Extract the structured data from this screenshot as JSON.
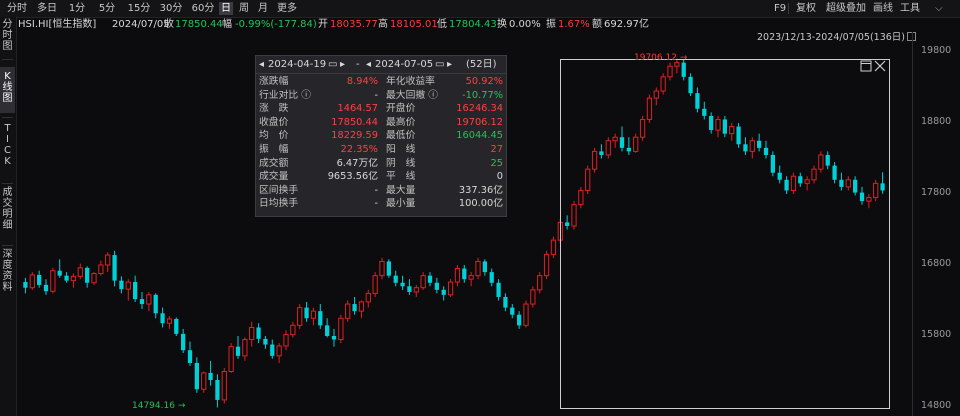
{
  "toolbar": {
    "timeframes": [
      "分时",
      "多日",
      "1分",
      "5分",
      "15分",
      "30分",
      "60分",
      "日",
      "周",
      "月",
      "更多"
    ],
    "active_timeframe": "日",
    "right": {
      "f9": "F9",
      "replay": "复权",
      "overlay": "超级叠加",
      "draw": "画线",
      "tools": "工具"
    }
  },
  "info": {
    "symbol": "HSI.HI[恒生指数]",
    "date": "2024/07/05",
    "close_label": "收",
    "close": "17850.44",
    "change_label": "幅",
    "change": "-0.99%(-177.84)",
    "open_label": "开",
    "open": "18035.77",
    "high_label": "高",
    "high": "18105.01",
    "low_label": "低",
    "low": "17804.43",
    "turnover_label": "换",
    "turnover": "0.00%",
    "amplitude_label": "振",
    "amplitude": "1.67%",
    "amount_label": "额",
    "amount": "692.97亿"
  },
  "left_tabs": [
    "分时图",
    "K线图",
    "TICK",
    "成交明细",
    "深度资料"
  ],
  "active_left_tab": "K线图",
  "range_label": "2023/12/13-2024/07/05(136日)",
  "y_axis": {
    "ticks": [
      "19800",
      "18800",
      "17800",
      "16800",
      "15800",
      "14800"
    ]
  },
  "highlights": {
    "high": "19706.12",
    "low": "14794.16"
  },
  "panel": {
    "start_date": "2024-04-19",
    "dash": "-",
    "end_date": "2024-07-05",
    "days": "(52日)",
    "rows": [
      {
        "l1": "涨跌幅",
        "v1": "8.94%",
        "l2": "年化收益率",
        "v2": "50.92%"
      },
      {
        "l1": "行业对比 ⓘ",
        "v1": "-",
        "l2": "最大回撤 ⓘ",
        "v2": "-10.77%"
      },
      {
        "l1": "涨　跌",
        "v1": "1464.57",
        "l2": "开盘价",
        "v2": "16246.34"
      },
      {
        "l1": "收盘价",
        "v1": "17850.44",
        "l2": "最高价",
        "v2": "19706.12"
      },
      {
        "l1": "均　价",
        "v1": "18229.59",
        "l2": "最低价",
        "v2": "16044.45"
      },
      {
        "l1": "振　幅",
        "v1": "22.35%",
        "l2": "阳　线",
        "v2": "27"
      },
      {
        "l1": "成交额",
        "v1": "6.47万亿",
        "l2": "阴　线",
        "v2": "25"
      },
      {
        "l1": "成交量",
        "v1": "9653.56亿",
        "l2": "平　线",
        "v2": "0"
      },
      {
        "l1": "区间换手",
        "v1": "-",
        "l2": "最大量",
        "v2": "337.36亿"
      },
      {
        "l1": "日均换手",
        "v1": "-",
        "l2": "最小量",
        "v2": "100.00亿"
      }
    ]
  },
  "colors": {
    "up": "#e02020",
    "down": "#00d0d8",
    "bg": "#0c0c0e"
  },
  "chart_data": {
    "type": "candlestick",
    "ylim": [
      14800,
      19800
    ],
    "up_color": "#e02020",
    "down_color": "#00d0d8",
    "candles": [
      [
        16560,
        16620,
        16400,
        16480
      ],
      [
        16480,
        16700,
        16450,
        16660
      ],
      [
        16660,
        16720,
        16480,
        16520
      ],
      [
        16520,
        16600,
        16380,
        16430
      ],
      [
        16430,
        16760,
        16400,
        16720
      ],
      [
        16720,
        16880,
        16620,
        16650
      ],
      [
        16650,
        16700,
        16550,
        16580
      ],
      [
        16580,
        16680,
        16480,
        16640
      ],
      [
        16640,
        16820,
        16600,
        16760
      ],
      [
        16760,
        16780,
        16480,
        16550
      ],
      [
        16550,
        16700,
        16520,
        16680
      ],
      [
        16680,
        16860,
        16650,
        16800
      ],
      [
        16800,
        16980,
        16700,
        16940
      ],
      [
        16940,
        17000,
        16500,
        16580
      ],
      [
        16580,
        16640,
        16400,
        16460
      ],
      [
        16460,
        16600,
        16300,
        16560
      ],
      [
        16560,
        16650,
        16280,
        16320
      ],
      [
        16320,
        16420,
        16180,
        16250
      ],
      [
        16250,
        16420,
        16150,
        16380
      ],
      [
        16380,
        16400,
        16050,
        16120
      ],
      [
        16120,
        16200,
        15920,
        15980
      ],
      [
        15980,
        16080,
        15900,
        16040
      ],
      [
        16040,
        16060,
        15800,
        15830
      ],
      [
        15830,
        15900,
        15560,
        15600
      ],
      [
        15600,
        15720,
        15380,
        15420
      ],
      [
        15420,
        15500,
        15000,
        15050
      ],
      [
        15050,
        15300,
        15000,
        15280
      ],
      [
        15280,
        15450,
        15100,
        15180
      ],
      [
        15180,
        15260,
        14794,
        14900
      ],
      [
        14900,
        15350,
        14850,
        15300
      ],
      [
        15300,
        15700,
        15280,
        15650
      ],
      [
        15650,
        15800,
        15480,
        15520
      ],
      [
        15520,
        15780,
        15450,
        15750
      ],
      [
        15750,
        16000,
        15650,
        15920
      ],
      [
        15920,
        15980,
        15700,
        15760
      ],
      [
        15760,
        15800,
        15620,
        15680
      ],
      [
        15680,
        15750,
        15480,
        15520
      ],
      [
        15520,
        15700,
        15420,
        15660
      ],
      [
        15660,
        15880,
        15600,
        15820
      ],
      [
        15820,
        16000,
        15780,
        15950
      ],
      [
        15950,
        16250,
        15900,
        16200
      ],
      [
        16200,
        16280,
        16000,
        16050
      ],
      [
        16050,
        16200,
        15950,
        16150
      ],
      [
        16150,
        16250,
        15900,
        15950
      ],
      [
        15950,
        16050,
        15780,
        15800
      ],
      [
        15800,
        15900,
        15650,
        15750
      ],
      [
        15750,
        16100,
        15700,
        16050
      ],
      [
        16050,
        16300,
        16000,
        16250
      ],
      [
        16250,
        16350,
        16100,
        16150
      ],
      [
        16150,
        16300,
        16050,
        16280
      ],
      [
        16280,
        16450,
        16200,
        16400
      ],
      [
        16400,
        16700,
        16350,
        16650
      ],
      [
        16650,
        16900,
        16600,
        16850
      ],
      [
        16850,
        16880,
        16620,
        16650
      ],
      [
        16650,
        16720,
        16500,
        16550
      ],
      [
        16550,
        16650,
        16450,
        16500
      ],
      [
        16500,
        16600,
        16380,
        16420
      ],
      [
        16420,
        16520,
        16350,
        16480
      ],
      [
        16480,
        16700,
        16450,
        16650
      ],
      [
        16650,
        16700,
        16500,
        16550
      ],
      [
        16550,
        16620,
        16400,
        16450
      ],
      [
        16450,
        16500,
        16300,
        16380
      ],
      [
        16380,
        16600,
        16350,
        16560
      ],
      [
        16560,
        16800,
        16500,
        16750
      ],
      [
        16750,
        16800,
        16550,
        16600
      ],
      [
        16600,
        16700,
        16500,
        16650
      ],
      [
        16650,
        16900,
        16600,
        16850
      ],
      [
        16850,
        16880,
        16650,
        16700
      ],
      [
        16700,
        16750,
        16500,
        16550
      ],
      [
        16550,
        16600,
        16300,
        16350
      ],
      [
        16350,
        16400,
        16150,
        16200
      ],
      [
        16200,
        16250,
        16050,
        16100
      ],
      [
        16100,
        16150,
        15900,
        15950
      ],
      [
        15950,
        16300,
        15920,
        16250
      ],
      [
        16250,
        16500,
        16200,
        16450
      ],
      [
        16450,
        16700,
        16400,
        16650
      ],
      [
        16650,
        17000,
        16600,
        16950
      ],
      [
        16950,
        17200,
        16900,
        17150
      ],
      [
        17150,
        17450,
        17100,
        17400
      ],
      [
        17400,
        17500,
        17300,
        17350
      ],
      [
        17350,
        17700,
        17300,
        17650
      ],
      [
        17650,
        17900,
        17600,
        17850
      ],
      [
        17850,
        18200,
        17800,
        18150
      ],
      [
        18150,
        18450,
        18100,
        18400
      ],
      [
        18400,
        18500,
        18300,
        18350
      ],
      [
        18350,
        18600,
        18300,
        18550
      ],
      [
        18550,
        18650,
        18450,
        18600
      ],
      [
        18600,
        18750,
        18400,
        18450
      ],
      [
        18450,
        18600,
        18350,
        18400
      ],
      [
        18400,
        18650,
        18380,
        18600
      ],
      [
        18600,
        18900,
        18550,
        18850
      ],
      [
        18850,
        19200,
        18800,
        19150
      ],
      [
        19150,
        19300,
        19050,
        19250
      ],
      [
        19250,
        19500,
        19200,
        19450
      ],
      [
        19450,
        19650,
        19400,
        19600
      ],
      [
        19600,
        19706,
        19500,
        19650
      ],
      [
        19650,
        19700,
        19400,
        19450
      ],
      [
        19450,
        19500,
        19180,
        19220
      ],
      [
        19220,
        19300,
        18950,
        19000
      ],
      [
        19000,
        19100,
        18850,
        18900
      ],
      [
        18900,
        18950,
        18650,
        18700
      ],
      [
        18700,
        18900,
        18600,
        18850
      ],
      [
        18850,
        18900,
        18600,
        18650
      ],
      [
        18650,
        18800,
        18550,
        18750
      ],
      [
        18750,
        18800,
        18450,
        18500
      ],
      [
        18500,
        18600,
        18350,
        18400
      ],
      [
        18400,
        18600,
        18300,
        18550
      ],
      [
        18550,
        18650,
        18400,
        18450
      ],
      [
        18450,
        18550,
        18300,
        18350
      ],
      [
        18350,
        18400,
        18050,
        18100
      ],
      [
        18100,
        18200,
        17950,
        18000
      ],
      [
        18000,
        18050,
        17800,
        17850
      ],
      [
        17850,
        18100,
        17800,
        18050
      ],
      [
        18050,
        18100,
        17900,
        17950
      ],
      [
        17950,
        18050,
        17850,
        18000
      ],
      [
        18000,
        18200,
        17950,
        18150
      ],
      [
        18150,
        18400,
        18100,
        18350
      ],
      [
        18350,
        18400,
        18150,
        18200
      ],
      [
        18200,
        18250,
        17950,
        18000
      ],
      [
        18000,
        18100,
        17850,
        17900
      ],
      [
        17900,
        18050,
        17850,
        18000
      ],
      [
        18000,
        18050,
        17780,
        17820
      ],
      [
        17820,
        17900,
        17650,
        17700
      ],
      [
        17700,
        17800,
        17600,
        17750
      ],
      [
        17750,
        18000,
        17700,
        17950
      ],
      [
        17950,
        18105,
        17804,
        17850
      ]
    ]
  }
}
